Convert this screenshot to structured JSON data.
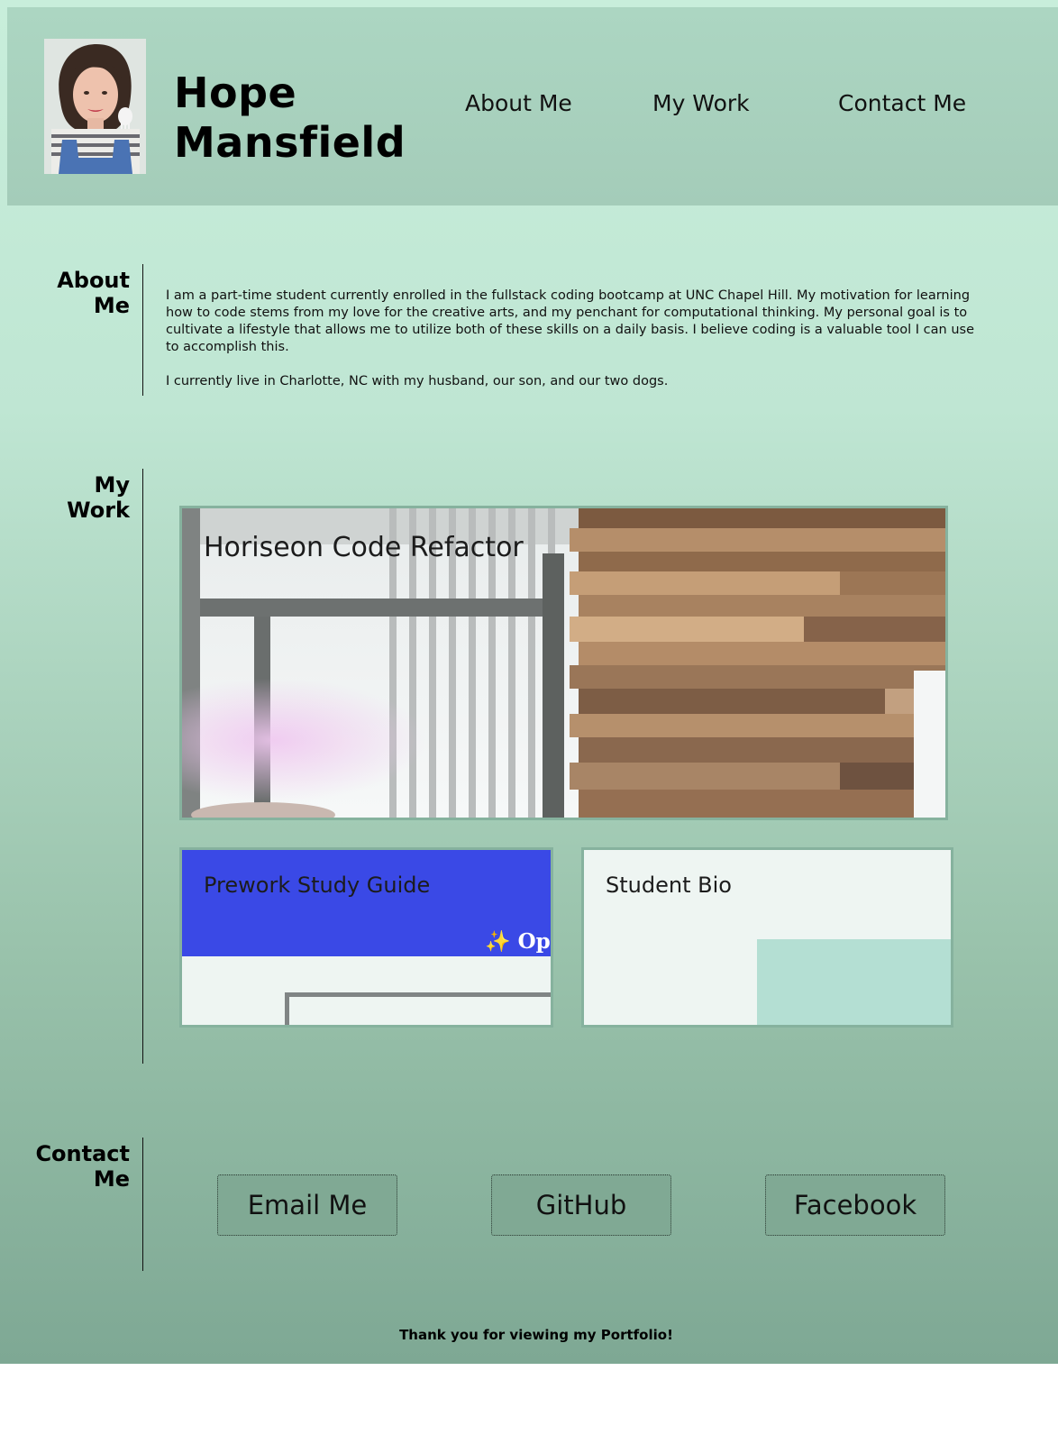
{
  "header": {
    "name_line1": "Hope",
    "name_line2": "Mansfield",
    "nav": [
      {
        "label": "About Me"
      },
      {
        "label": "My Work"
      },
      {
        "label": "Contact Me"
      }
    ]
  },
  "about": {
    "heading_line1": "About",
    "heading_line2": "Me",
    "paragraphs": [
      "I am a part-time student currently enrolled in the fullstack coding bootcamp at UNC Chapel Hill. My motivation for learning how to code stems from my love for the creative arts, and my penchant for computational thinking. My personal goal is to cultivate a lifestyle that allows me to utilize both of these skills on a daily basis. I believe coding is a valuable tool I can use to accomplish this.",
      "I currently live in Charlotte, NC with my husband, our son, and our two dogs."
    ]
  },
  "work": {
    "heading_line1": "My",
    "heading_line2": "Work",
    "projects": [
      {
        "title": "Horiseon Code Refactor"
      },
      {
        "title": "Prework Study Guide",
        "preview_text": "✨ Ope"
      },
      {
        "title": "Student Bio"
      }
    ]
  },
  "contact": {
    "heading_line1": "Contact",
    "heading_line2": "Me",
    "buttons": [
      {
        "label": "Email Me"
      },
      {
        "label": "GitHub"
      },
      {
        "label": "Facebook"
      }
    ]
  },
  "footer": {
    "text": "Thank you for viewing my Portfolio!"
  },
  "colors": {
    "header_bg": "#a8d2be",
    "accent_blue": "#3a49e6",
    "card_border": "#86b29e",
    "button_bg": "#80a994"
  }
}
